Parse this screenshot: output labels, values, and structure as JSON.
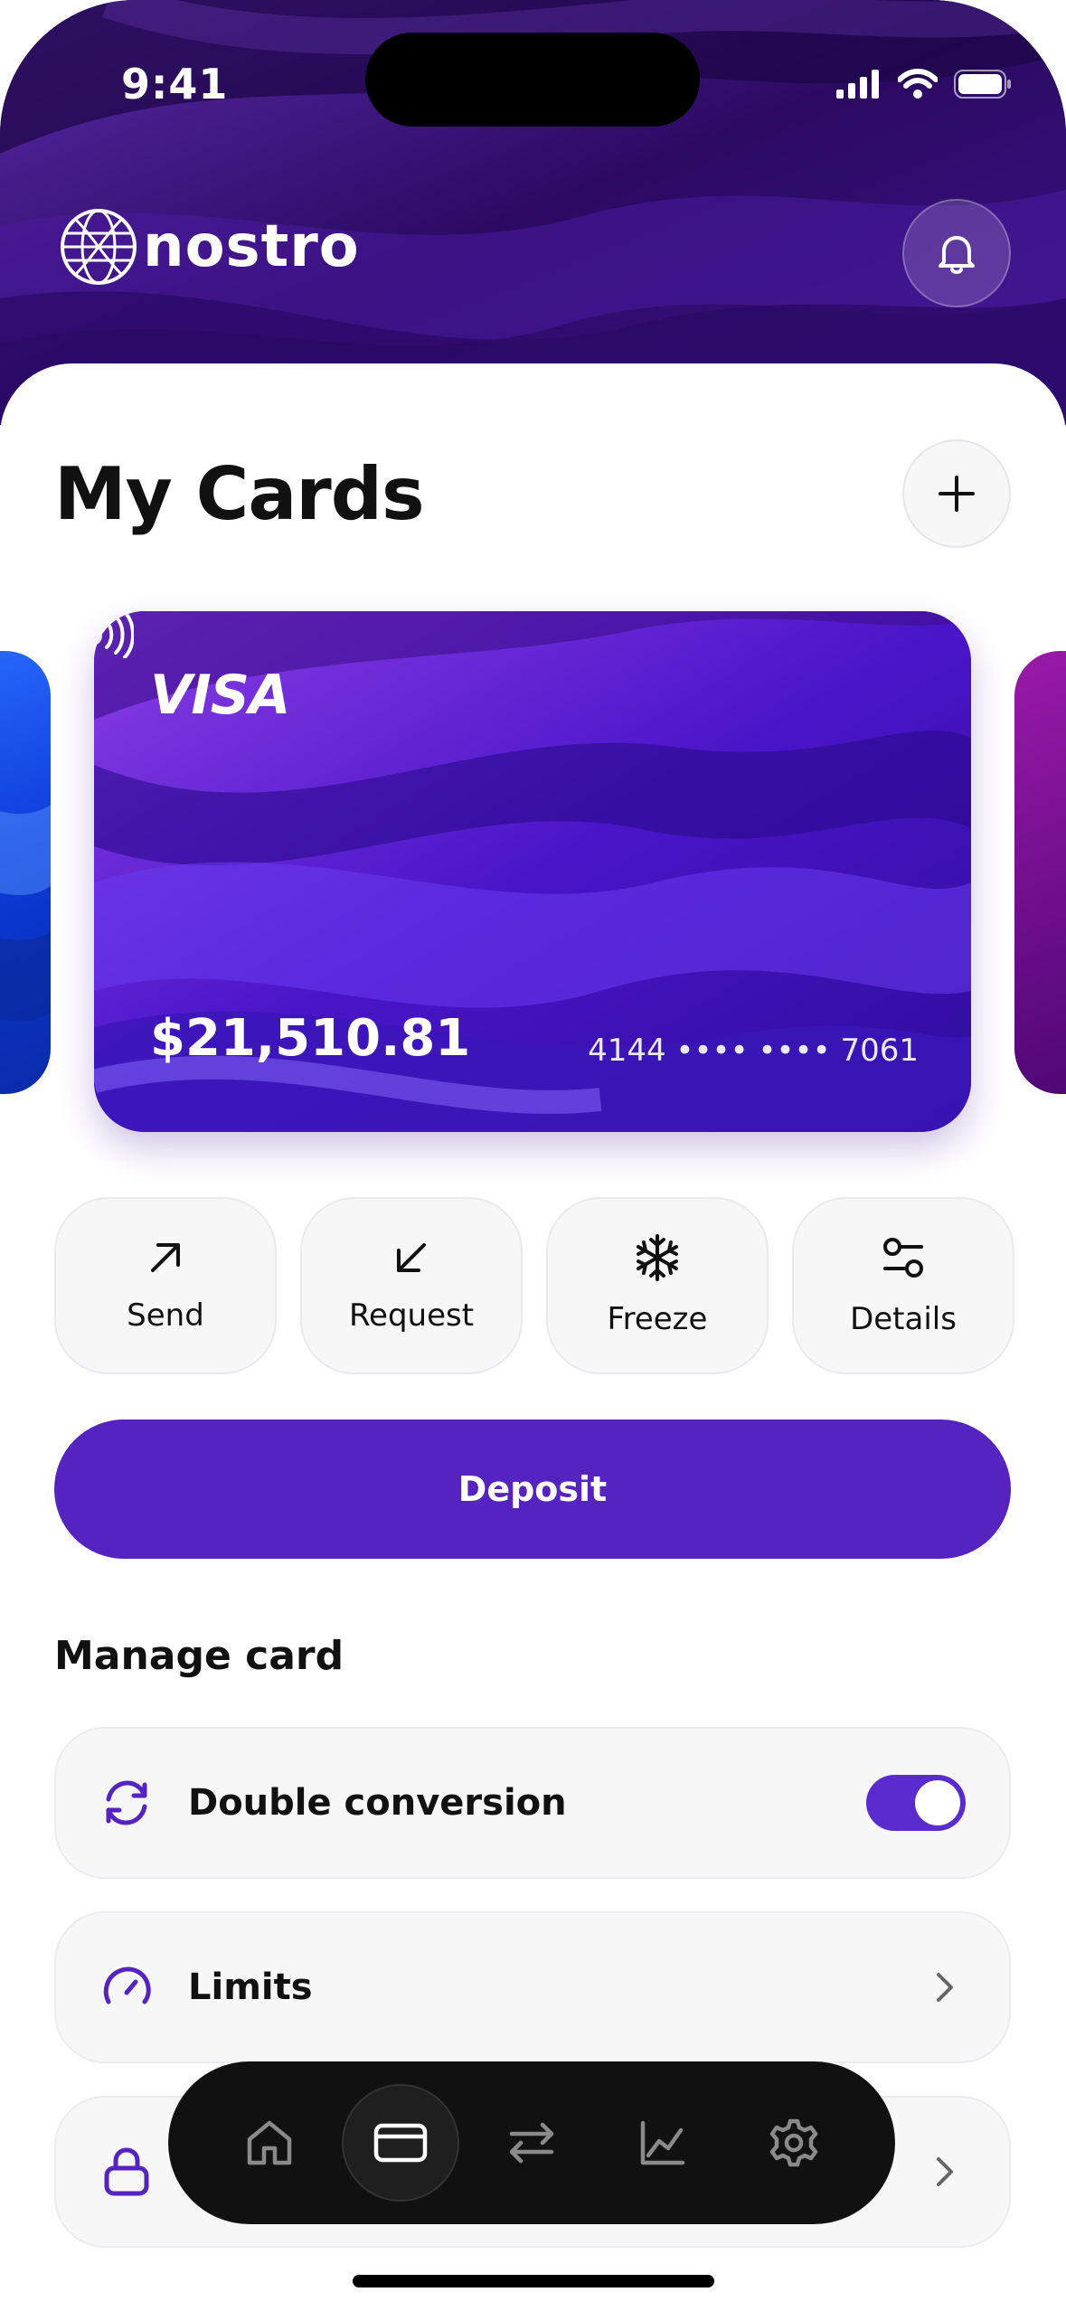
{
  "status_bar": {
    "time": "9:41"
  },
  "brand": {
    "name": "nostro"
  },
  "page": {
    "title": "My Cards"
  },
  "card": {
    "network": "VISA",
    "balance": "$21,510.81",
    "number_masked": "4144 •••• •••• 7061"
  },
  "actions": [
    {
      "label": "Send",
      "icon": "arrow-up-right-icon"
    },
    {
      "label": "Request",
      "icon": "arrow-down-left-icon"
    },
    {
      "label": "Freeze",
      "icon": "snowflake-icon"
    },
    {
      "label": "Details",
      "icon": "sliders-icon"
    }
  ],
  "deposit": {
    "label": "Deposit"
  },
  "manage": {
    "title": "Manage card",
    "rows": [
      {
        "label": "Double conversion",
        "icon": "refresh-icon",
        "toggle_on": true
      },
      {
        "label": "Limits",
        "icon": "gauge-icon"
      },
      {
        "label": "",
        "icon": "lock-icon"
      }
    ]
  },
  "tabbar": {
    "items": [
      "home-icon",
      "card-icon",
      "transfer-icon",
      "chart-icon",
      "settings-icon"
    ],
    "active": "card-icon"
  },
  "colors": {
    "accent": "#5523bf",
    "toggle": "#5a2cd0",
    "header_bg": "#2a0a5e",
    "tabbar_bg": "#111111"
  }
}
